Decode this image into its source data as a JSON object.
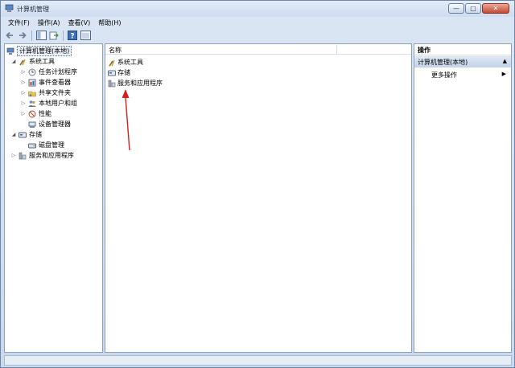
{
  "window": {
    "title": "计算机管理",
    "controls": {
      "minimize": "—",
      "maximize": "□",
      "close": "✕"
    }
  },
  "menubar": {
    "items": [
      "文件(F)",
      "操作(A)",
      "查看(V)",
      "帮助(H)"
    ]
  },
  "toolbar": {
    "buttons": [
      "back-icon",
      "forward-icon",
      "console-tree-icon",
      "export-icon",
      "help-icon",
      "properties-icon"
    ]
  },
  "tree": {
    "root": "计算机管理(本地)",
    "items": [
      {
        "label": "系统工具",
        "icon": "tools-icon",
        "expander": "◢"
      },
      {
        "label": "任务计划程序",
        "icon": "clock-icon",
        "expander": "▷"
      },
      {
        "label": "事件查看器",
        "icon": "event-viewer-icon",
        "expander": "▷"
      },
      {
        "label": "共享文件夹",
        "icon": "shared-folder-icon",
        "expander": "▷"
      },
      {
        "label": "本地用户和组",
        "icon": "users-icon",
        "expander": "▷"
      },
      {
        "label": "性能",
        "icon": "performance-icon",
        "expander": "▷"
      },
      {
        "label": "设备管理器",
        "icon": "device-manager-icon",
        "expander": ""
      },
      {
        "label": "存储",
        "icon": "storage-icon",
        "expander": "◢"
      },
      {
        "label": "磁盘管理",
        "icon": "disk-icon",
        "expander": ""
      },
      {
        "label": "服务和应用程序",
        "icon": "services-icon",
        "expander": "▷"
      }
    ]
  },
  "center": {
    "column_header": "名称",
    "rows": [
      "系统工具",
      "存储",
      "服务和应用程序"
    ]
  },
  "actions": {
    "title": "操作",
    "group": "计算机管理(本地)",
    "group_caret": "▲",
    "more": "更多操作",
    "more_arrow": "▶"
  },
  "colors": {
    "window_frame": "#c9d9ee",
    "pane_bg": "#ffffff",
    "annotation_arrow": "#d32020"
  }
}
